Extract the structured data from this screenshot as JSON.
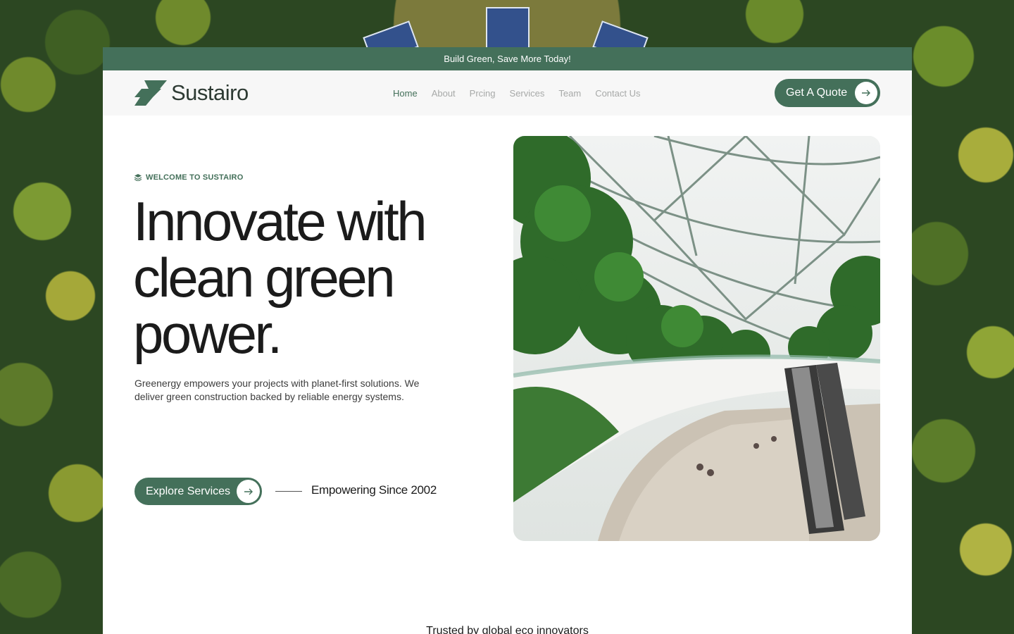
{
  "announcement": "Build Green, Save More Today!",
  "brand": {
    "name": "Sustairo",
    "accent": "#44705a"
  },
  "nav": {
    "items": [
      {
        "label": "Home",
        "active": true
      },
      {
        "label": "About",
        "active": false
      },
      {
        "label": "Prcing",
        "active": false
      },
      {
        "label": "Services",
        "active": false
      },
      {
        "label": "Team",
        "active": false
      },
      {
        "label": "Contact Us",
        "active": false
      }
    ],
    "cta_label": "Get A Quote",
    "cta_icon": "arrow-right-icon"
  },
  "hero": {
    "eyebrow": "WELCOME TO SUSTAIRO",
    "eyebrow_icon": "layers-icon",
    "headline_line1": "Innovate with",
    "headline_line2": "clean green",
    "headline_line3": "power.",
    "description": "Greenergy empowers your projects with planet-first solutions. We deliver green construction backed by reliable energy systems.",
    "primary_button": "Explore Services",
    "since_text": "Empowering Since 2002"
  },
  "trusted": "Trusted by global eco innovators"
}
